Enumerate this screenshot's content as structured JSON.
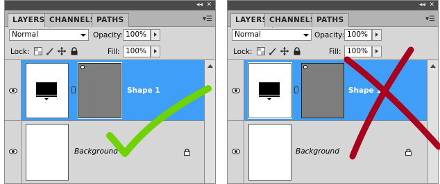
{
  "panels": [
    {
      "tabs": [
        "LAYERS",
        "CHANNELS",
        "PATHS"
      ],
      "blend_mode": "Normal",
      "opacity_label": "Opacity:",
      "opacity_value": "100%",
      "lock_label": "Lock:",
      "fill_label": "Fill:",
      "fill_value": "100%",
      "layers": [
        {
          "name": "Shape 1",
          "selected": true
        },
        {
          "name": "Background",
          "selected": false
        }
      ],
      "verdict": "correct",
      "verdict_color": "#6fd300"
    },
    {
      "tabs": [
        "LAYERS",
        "CHANNELS",
        "PATHS"
      ],
      "blend_mode": "Normal",
      "opacity_label": "Opacity:",
      "opacity_value": "100%",
      "lock_label": "Lock:",
      "fill_label": "Fill:",
      "fill_value": "100%",
      "layers": [
        {
          "name": "Shape 1",
          "selected": true
        },
        {
          "name": "Background",
          "selected": false
        }
      ],
      "verdict": "incorrect",
      "verdict_color": "#a8001c"
    }
  ],
  "colors": {
    "selection": "#3f9ef7",
    "panel_bg": "#d6d6d6",
    "titlebar": "#4b4b4b"
  },
  "icons": [
    "eye-icon",
    "lock-transparent-icon",
    "lock-brush-icon",
    "lock-move-icon",
    "lock-all-icon",
    "link-icon",
    "panel-menu-icon",
    "collapse-icon",
    "close-icon",
    "checkmark-icon",
    "cross-icon"
  ]
}
